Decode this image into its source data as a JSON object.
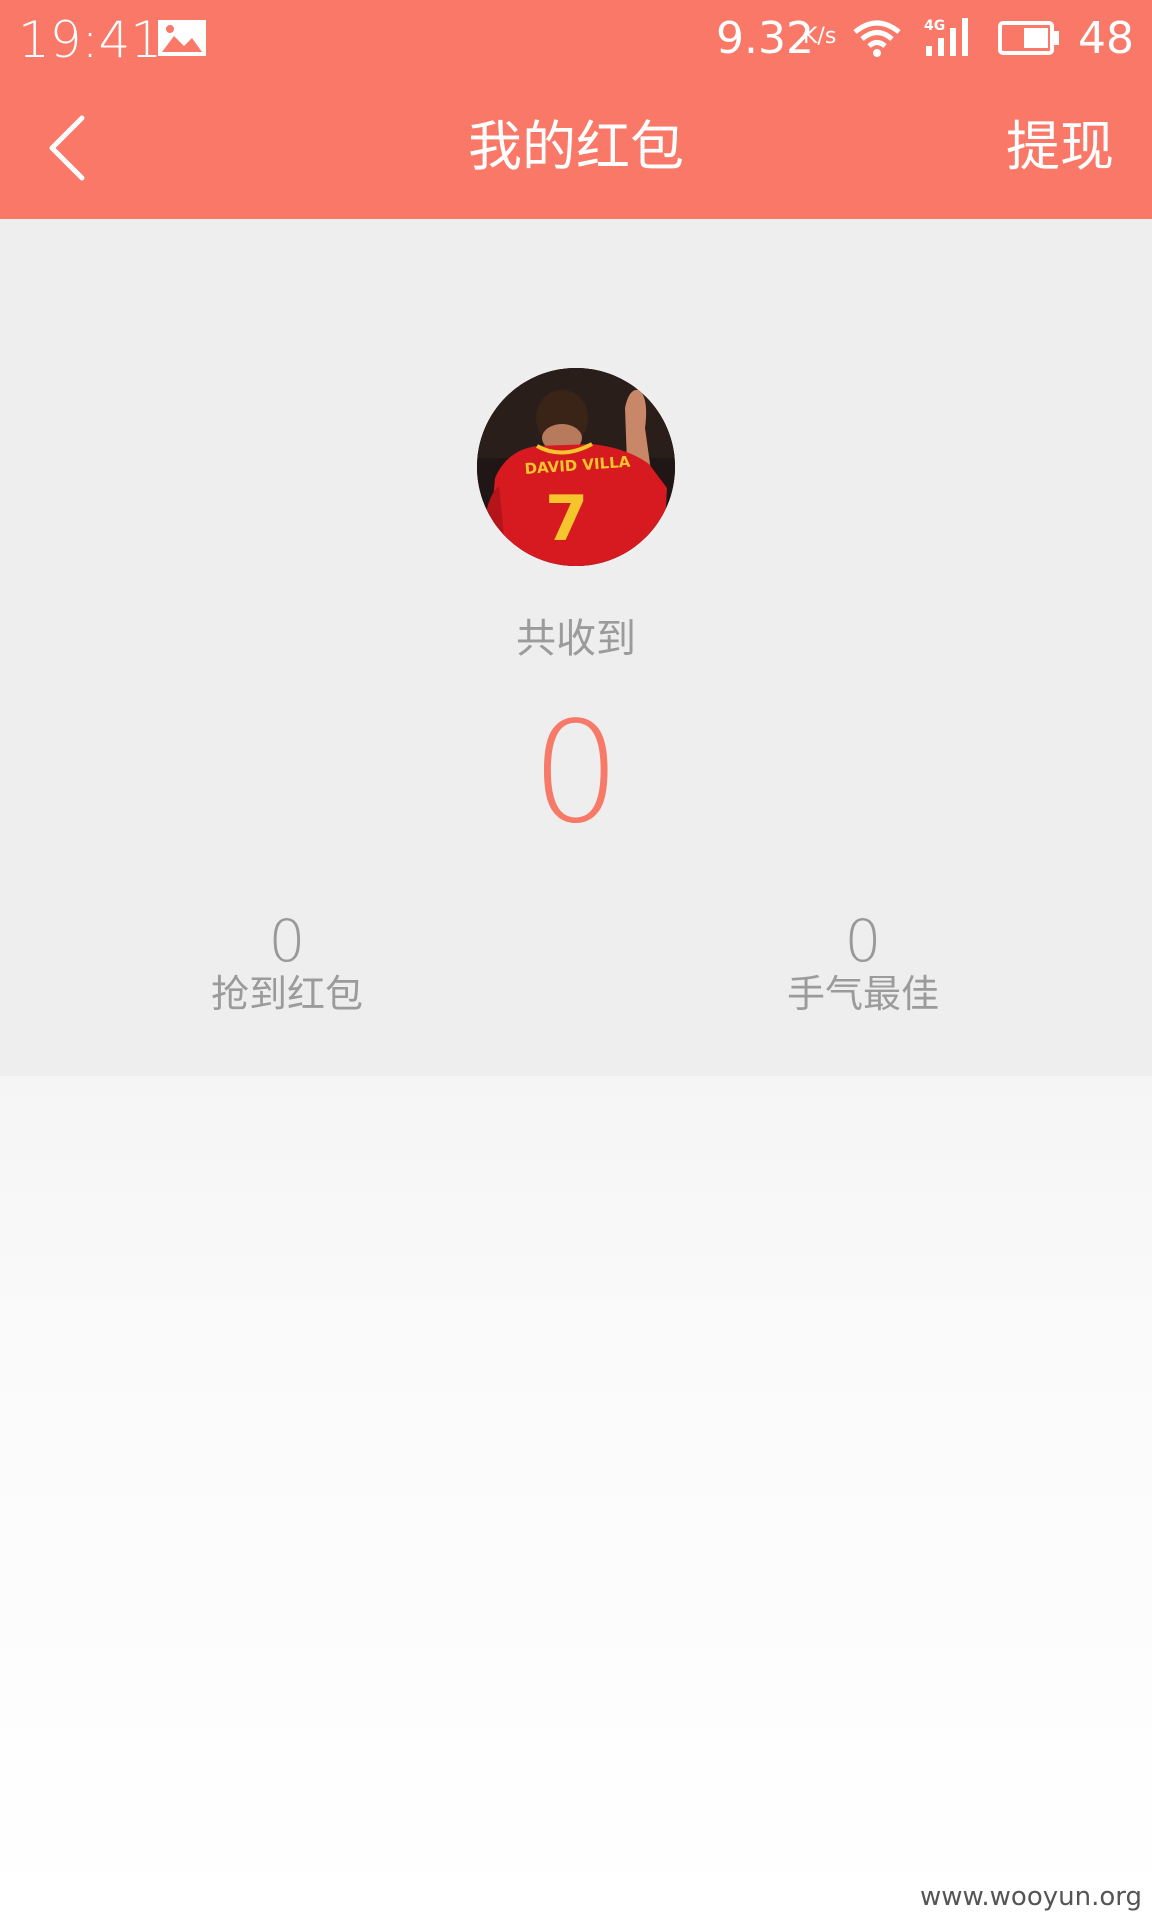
{
  "status_bar": {
    "time": "19:41",
    "speed": "9.32",
    "speed_unit": "K/s",
    "network": "4G",
    "battery": "48",
    "icons": [
      "image-icon",
      "wifi-icon",
      "signal-4g-icon",
      "battery-icon"
    ]
  },
  "header": {
    "back_icon": "chevron-left-icon",
    "title": "我的红包",
    "withdraw": "提现"
  },
  "summary": {
    "total_label": "共收到",
    "total_value": "0",
    "stats": [
      {
        "value": "0",
        "label": "抢到红包"
      },
      {
        "value": "0",
        "label": "手气最佳"
      }
    ]
  },
  "avatar": {
    "jersey_name": "DAVID VILLA",
    "jersey_number": "7"
  },
  "watermark": "www.wooyun.org",
  "colors": {
    "accent": "#fa7867",
    "total_value": "#f77a68",
    "panel_bg": "#efeeee",
    "muted_text": "#9b9b9b"
  }
}
